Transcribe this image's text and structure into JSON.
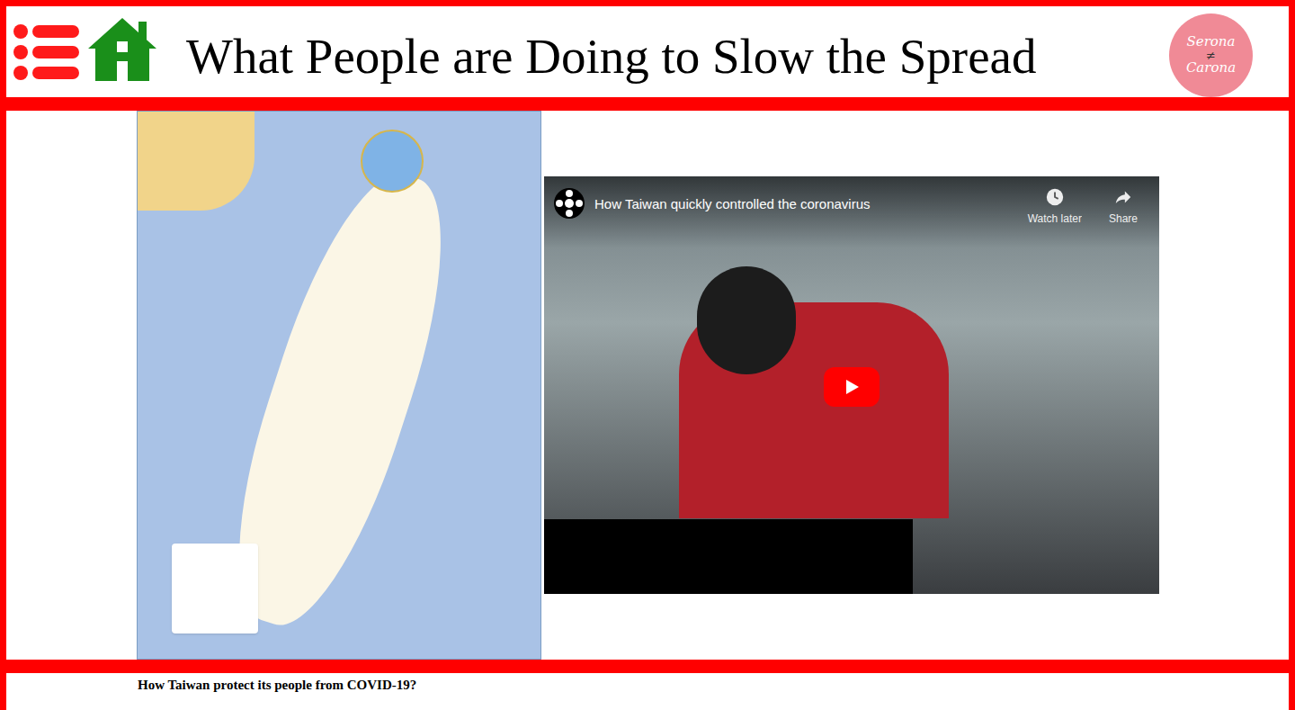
{
  "header": {
    "title": "What People are Doing to Slow the Spread",
    "logo": {
      "top": "Serona",
      "middle": "≠",
      "bottom": "Carona"
    }
  },
  "video": {
    "title": "How Taiwan quickly controlled the coronavirus",
    "actions": [
      "Watch later",
      "Share"
    ]
  },
  "section": {
    "heading": "How Taiwan protect its people from COVID-19?"
  }
}
